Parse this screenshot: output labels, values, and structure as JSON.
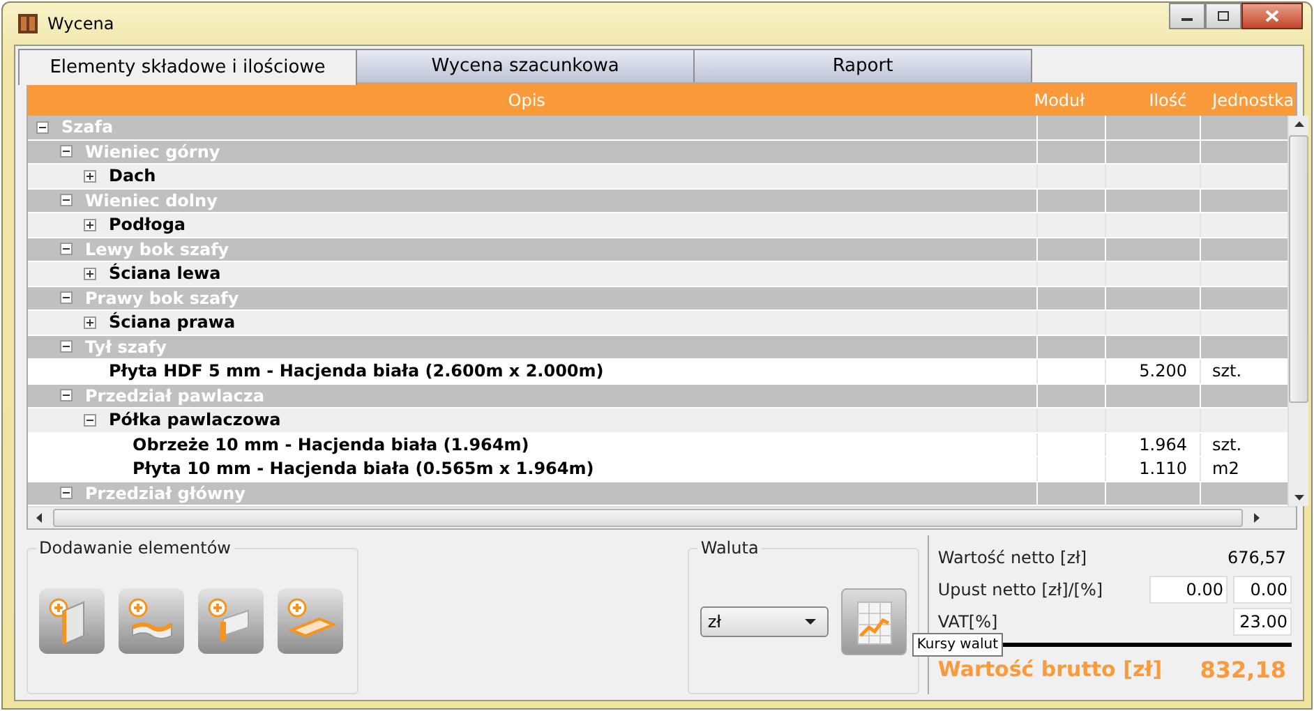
{
  "window": {
    "title": "Wycena"
  },
  "tabs": [
    {
      "label": "Elementy składowe i ilościowe",
      "selected": true
    },
    {
      "label": "Wycena szacunkowa",
      "selected": false
    },
    {
      "label": "Raport",
      "selected": false
    }
  ],
  "table": {
    "columns": [
      "Opis",
      "Moduł",
      "Ilość",
      "Jednostka"
    ],
    "tree": [
      {
        "kind": "group",
        "label": "Szafa",
        "expanded": true,
        "children": [
          {
            "kind": "group",
            "label": "Wieniec górny",
            "expanded": true,
            "children": [
              {
                "kind": "part",
                "label": "Dach",
                "expanded": false
              }
            ]
          },
          {
            "kind": "group",
            "label": "Wieniec dolny",
            "expanded": true,
            "children": [
              {
                "kind": "part",
                "label": "Podłoga",
                "expanded": false
              }
            ]
          },
          {
            "kind": "group",
            "label": "Lewy bok szafy",
            "expanded": true,
            "children": [
              {
                "kind": "part",
                "label": "Ściana lewa",
                "expanded": false
              }
            ]
          },
          {
            "kind": "group",
            "label": "Prawy bok szafy",
            "expanded": true,
            "children": [
              {
                "kind": "part",
                "label": "Ściana prawa",
                "expanded": false
              }
            ]
          },
          {
            "kind": "group",
            "label": "Tył szafy",
            "expanded": true,
            "children": [
              {
                "kind": "material",
                "label": "Płyta HDF 5 mm - Hacjenda biała (2.600m x 2.000m)",
                "quantity": "5.200",
                "unit": "szt."
              }
            ]
          },
          {
            "kind": "group",
            "label": "Przedział pawlacza",
            "expanded": true,
            "children": [
              {
                "kind": "part",
                "label": "Półka pawlaczowa",
                "expanded": true,
                "children": [
                  {
                    "kind": "material",
                    "label": "Obrzeże 10 mm - Hacjenda biała (1.964m)",
                    "quantity": "1.964",
                    "unit": "szt."
                  },
                  {
                    "kind": "material",
                    "label": "Płyta 10 mm - Hacjenda biała (0.565m x 1.964m)",
                    "quantity": "1.110",
                    "unit": "m2"
                  }
                ]
              }
            ]
          },
          {
            "kind": "group",
            "label": "Przedział główny",
            "expanded": true
          }
        ]
      }
    ]
  },
  "adding_panel": {
    "title": "Dodawanie elementów"
  },
  "currency_panel": {
    "title": "Waluta",
    "currency": "zł",
    "tooltip": "Kursy walut"
  },
  "summary": {
    "net_label": "Wartość netto [zł]",
    "net_value": "676,57",
    "discount_label": "Upust netto [zł]/[%]",
    "discount_amount": "0.00",
    "discount_percent": "0.00",
    "vat_label": "VAT[%]",
    "vat_value": "23.00",
    "gross_label": "Wartość brutto [zł]",
    "gross_value": "832,18"
  }
}
